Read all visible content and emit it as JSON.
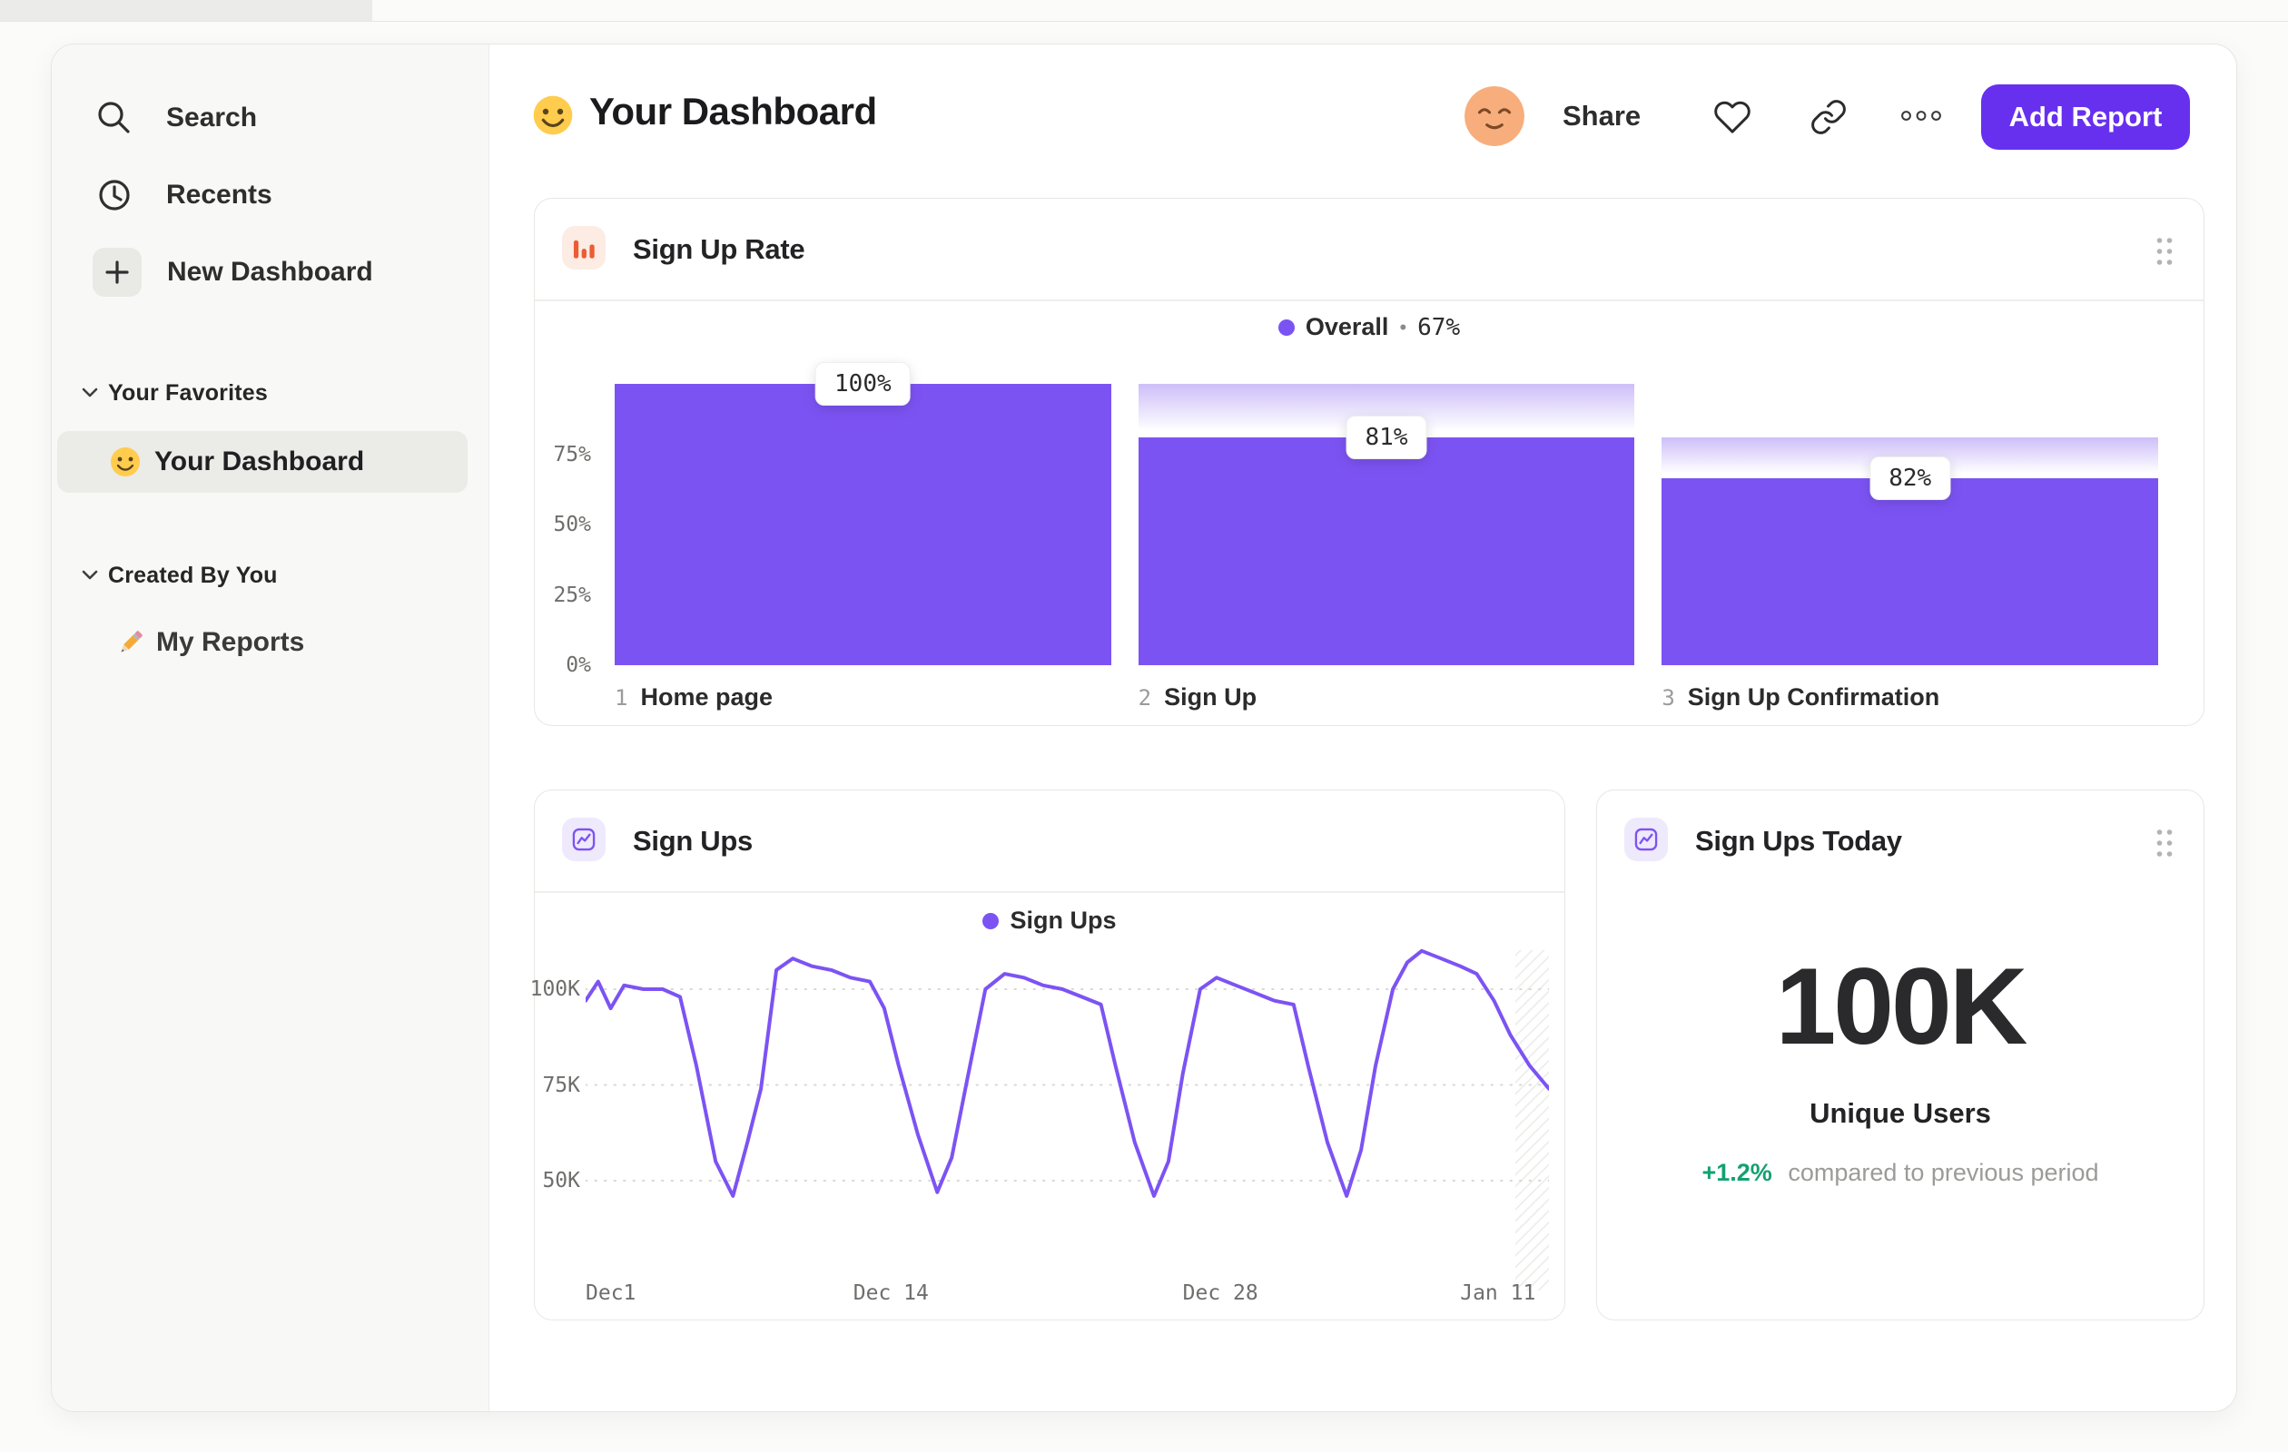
{
  "header": {
    "dashboard_emoji": "🙂",
    "title": "Your Dashboard",
    "avatar_emoji": "😌",
    "share_label": "Share",
    "add_report_label": "Add Report"
  },
  "sidebar": {
    "items": [
      {
        "label": "Search",
        "icon": "magnifier"
      },
      {
        "label": "Recents",
        "icon": "clock"
      },
      {
        "label": "New Dashboard",
        "icon": "plus"
      }
    ],
    "sections": [
      {
        "title": "Your Favorites",
        "items": [
          {
            "emoji": "🙂",
            "label": "Your Dashboard",
            "selected": true
          }
        ]
      },
      {
        "title": "Created By You",
        "items": [
          {
            "emoji": "✏️",
            "label": "My Reports",
            "selected": false
          }
        ]
      }
    ]
  },
  "icons": {
    "search": "magnifier",
    "recents": "clock",
    "new_dashboard": "plus",
    "section_toggle": "chevron-down",
    "favorite": "heart-outline",
    "copy_link": "link",
    "more": "ellipsis-circles",
    "drag": "drag-handle-dots",
    "signup_rate_card": "bar-chart",
    "signups_card": "line-chart",
    "signups_today_card": "line-chart"
  },
  "colors": {
    "chart_purple": "#7C53F3",
    "button_purple": "#6730EE",
    "icon_orange": "#EE5B33",
    "positive_green": "#12A170"
  },
  "chart_data": [
    {
      "type": "bar",
      "subtype": "funnel",
      "title": "Sign Up Rate",
      "legend": [
        {
          "name": "Overall",
          "value": "67%",
          "color": "#7C53F3"
        }
      ],
      "legend_sep": "•",
      "ylim": [
        0,
        100
      ],
      "y_ticks": [
        {
          "label": "75%",
          "value": 75
        },
        {
          "label": "50%",
          "value": 50
        },
        {
          "label": "25%",
          "value": 25
        },
        {
          "label": "0%",
          "value": 0
        }
      ],
      "steps": [
        {
          "index": 1,
          "name": "Home page",
          "conversion_from_previous": "100%",
          "overall_pct": 100
        },
        {
          "index": 2,
          "name": "Sign Up",
          "conversion_from_previous": "81%",
          "overall_pct": 81
        },
        {
          "index": 3,
          "name": "Sign Up Confirmation",
          "conversion_from_previous": "82%",
          "overall_pct": 66.4
        }
      ]
    },
    {
      "type": "line",
      "title": "Sign Ups",
      "unit": "K",
      "ylim": [
        40,
        115
      ],
      "grid": "dotted-horizontal",
      "legend_position": "top-center",
      "y_ticks": [
        {
          "label": "100K",
          "value": 100
        },
        {
          "label": "75K",
          "value": 75
        },
        {
          "label": "50K",
          "value": 50
        }
      ],
      "x_ticks": [
        {
          "label": "Dec1",
          "x_pct": 0,
          "align": "left"
        },
        {
          "label": "Dec 14",
          "x_pct": 31.7
        },
        {
          "label": "Dec 28",
          "x_pct": 65.9
        },
        {
          "label": "Jan 11",
          "x_pct": 94.7
        }
      ],
      "series": [
        {
          "name": "Sign Ups",
          "color": "#7C53F3",
          "points": [
            [
              0,
              97
            ],
            [
              1.3,
              102
            ],
            [
              2.6,
              95
            ],
            [
              4,
              101
            ],
            [
              6,
              100
            ],
            [
              8,
              100
            ],
            [
              9.8,
              98
            ],
            [
              11.5,
              80
            ],
            [
              13.5,
              55
            ],
            [
              15.3,
              46
            ],
            [
              16.8,
              60
            ],
            [
              18.2,
              74
            ],
            [
              19.8,
              105
            ],
            [
              21.5,
              108
            ],
            [
              23.5,
              106
            ],
            [
              25.5,
              105
            ],
            [
              27.5,
              103
            ],
            [
              29.5,
              102
            ],
            [
              31,
              95
            ],
            [
              32.5,
              80
            ],
            [
              34.5,
              62
            ],
            [
              36.5,
              47
            ],
            [
              38,
              56
            ],
            [
              39.5,
              75
            ],
            [
              41.5,
              100
            ],
            [
              43.5,
              104
            ],
            [
              45.5,
              103
            ],
            [
              47.5,
              101
            ],
            [
              49.5,
              100
            ],
            [
              51.5,
              98
            ],
            [
              53.5,
              96
            ],
            [
              55,
              80
            ],
            [
              57,
              60
            ],
            [
              59,
              46
            ],
            [
              60.5,
              55
            ],
            [
              62,
              78
            ],
            [
              63.8,
              100
            ],
            [
              65.5,
              103
            ],
            [
              67.5,
              101
            ],
            [
              69.5,
              99
            ],
            [
              71.5,
              97
            ],
            [
              73.5,
              96
            ],
            [
              75,
              80
            ],
            [
              77,
              60
            ],
            [
              79,
              46
            ],
            [
              80.5,
              58
            ],
            [
              82,
              80
            ],
            [
              83.8,
              100
            ],
            [
              85.3,
              107
            ],
            [
              86.8,
              110
            ],
            [
              88.8,
              108
            ],
            [
              90.8,
              106
            ],
            [
              92.5,
              104
            ],
            [
              94.3,
              97
            ],
            [
              96,
              88
            ],
            [
              98,
              80
            ],
            [
              100,
              74
            ]
          ]
        }
      ]
    },
    {
      "type": "metric",
      "title": "Sign Ups Today",
      "value": "100K",
      "label": "Unique Users",
      "change_pct": "+1.2%",
      "change_text": "compared to previous period",
      "change_color": "#12A170"
    }
  ]
}
